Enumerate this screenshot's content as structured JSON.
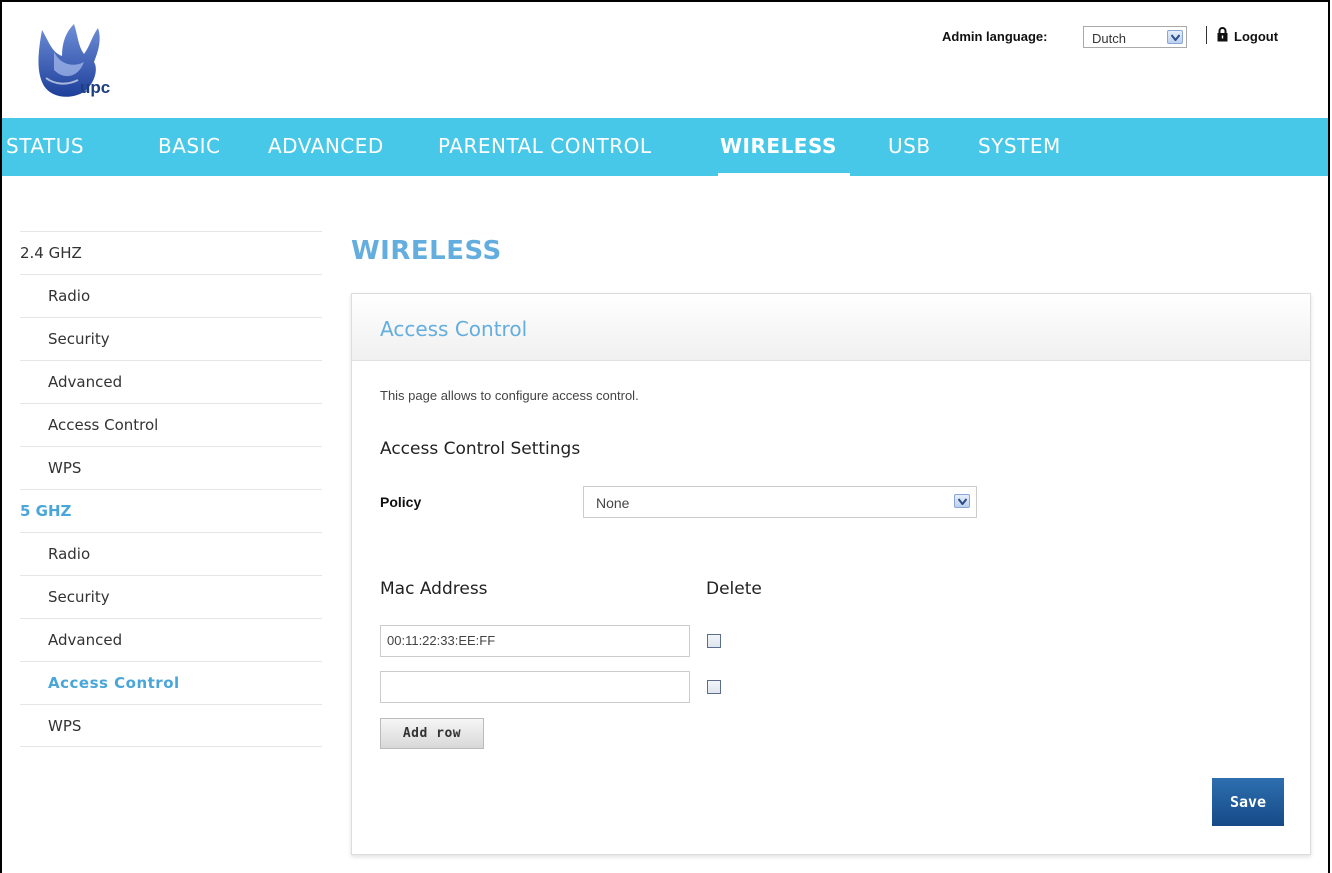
{
  "header": {
    "logo_text": "upc",
    "admin_language_label": "Admin language:",
    "admin_language_value": "Dutch",
    "logout_label": "Logout"
  },
  "nav": {
    "items": [
      "STATUS",
      "BASIC",
      "ADVANCED",
      "PARENTAL CONTROL",
      "WIRELESS",
      "USB",
      "SYSTEM"
    ],
    "active": "WIRELESS"
  },
  "sidebar": {
    "items": [
      {
        "label": "2.4 GHZ",
        "level": "group",
        "highlight": false
      },
      {
        "label": "Radio",
        "level": "sub",
        "highlight": false
      },
      {
        "label": "Security",
        "level": "sub",
        "highlight": false
      },
      {
        "label": "Advanced",
        "level": "sub",
        "highlight": false
      },
      {
        "label": "Access Control",
        "level": "sub",
        "highlight": false
      },
      {
        "label": "WPS",
        "level": "sub",
        "highlight": false
      },
      {
        "label": "5 GHZ",
        "level": "group",
        "highlight": true
      },
      {
        "label": "Radio",
        "level": "sub",
        "highlight": false
      },
      {
        "label": "Security",
        "level": "sub",
        "highlight": false
      },
      {
        "label": "Advanced",
        "level": "sub",
        "highlight": false
      },
      {
        "label": "Access Control",
        "level": "sub",
        "highlight": true
      },
      {
        "label": "WPS",
        "level": "sub",
        "highlight": false
      }
    ]
  },
  "main": {
    "page_title": "WIRELESS",
    "panel_title": "Access Control",
    "description": "This page allows to configure access control.",
    "section_title": "Access Control Settings",
    "policy_label": "Policy",
    "policy_value": "None",
    "mac_header": "Mac Address",
    "delete_header": "Delete",
    "mac_rows": [
      {
        "value": "00:11:22:33:EE:FF",
        "delete_checked": false
      },
      {
        "value": "",
        "delete_checked": false
      }
    ],
    "add_row_label": "Add row",
    "save_label": "Save"
  },
  "colors": {
    "nav_bg": "#48c8e8",
    "accent": "#63aede",
    "highlight": "#4aa6d8",
    "save_bg": "#1c5a99"
  }
}
